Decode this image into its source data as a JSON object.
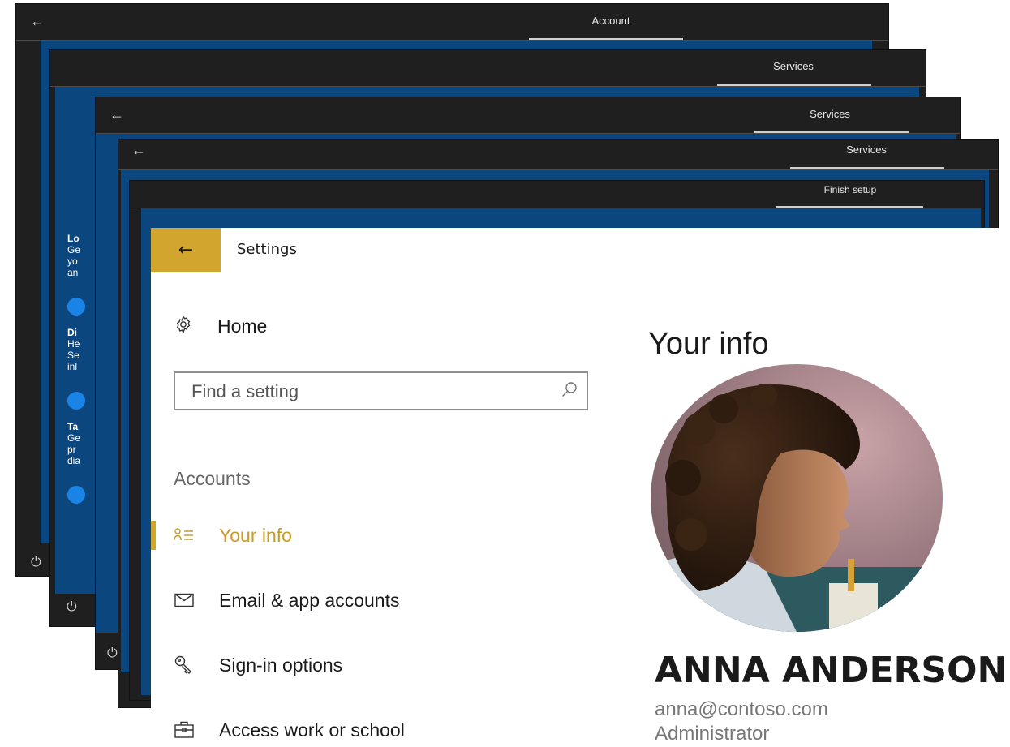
{
  "background_windows": [
    {
      "title": "Account",
      "has_back": true
    },
    {
      "title": "Services",
      "has_back": false
    },
    {
      "title": "Services",
      "has_back": true
    },
    {
      "title": "Services",
      "has_back": true
    },
    {
      "title": "Finish setup",
      "has_back": false
    }
  ],
  "bg_fragments": [
    [
      "Lo",
      "Ge",
      "yo",
      "an"
    ],
    [
      "Di",
      "He",
      "Se",
      "inl"
    ],
    [
      "Ta",
      "Ge",
      "pr",
      "dia"
    ]
  ],
  "settings": {
    "app_title": "Settings",
    "back_icon": "back-arrow-icon",
    "home": {
      "label": "Home",
      "icon": "gear-icon"
    },
    "search": {
      "placeholder": "Find a setting",
      "icon": "search-icon"
    },
    "section": "Accounts",
    "nav": [
      {
        "label": "Your info",
        "icon": "person-list-icon",
        "active": true
      },
      {
        "label": "Email & app accounts",
        "icon": "mail-icon",
        "active": false
      },
      {
        "label": "Sign-in options",
        "icon": "key-icon",
        "active": false
      },
      {
        "label": "Access work or school",
        "icon": "briefcase-icon",
        "active": false
      }
    ],
    "page_title": "Your info",
    "user": {
      "name": "ANNA ANDERSON",
      "email": "anna@contoso.com",
      "role": "Administrator"
    },
    "colors": {
      "accent": "#d1a52e",
      "accent_text": "#c59a26",
      "oobe_blue": "#0b467f",
      "titlebar": "#1f1f1f"
    }
  }
}
